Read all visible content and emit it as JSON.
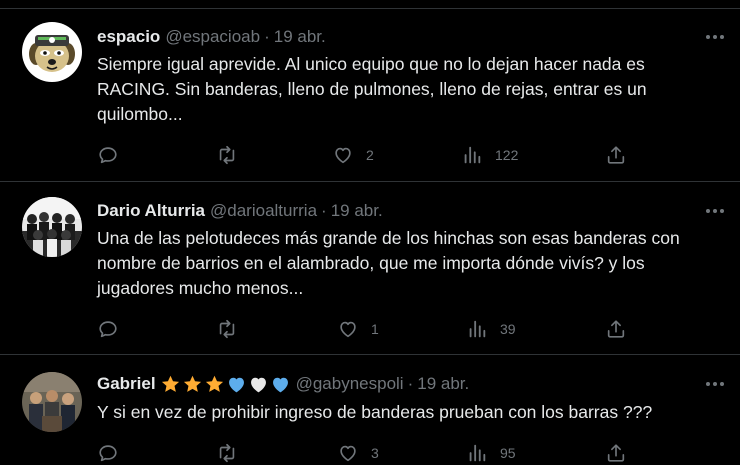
{
  "colors": {
    "background": "#000000",
    "text_primary": "#e7e9ea",
    "text_secondary": "#71767b",
    "divider": "#2f3336"
  },
  "tweets": [
    {
      "name": "espacio",
      "handle": "@espacioab",
      "separator": "·",
      "date": "19 abr.",
      "text": "Siempre igual aprevide. Al unico equipo que no lo dejan hacer nada es RACING. Sin banderas, lleno de pulmones, lleno de rejas, entrar es un quilombo...",
      "avatar_icon": "cartoon-dog-avatar",
      "replies": "",
      "retweets": "",
      "likes": "2",
      "views": "122"
    },
    {
      "name": "Dario Alturria",
      "handle": "@darioalturria",
      "separator": "·",
      "date": "19 abr.",
      "text": "Una de las pelotudeces más grande de los hinchas son esas banderas con nombre de barrios en el alambrado, que me importa dónde vivís? y los jugadores mucho menos...",
      "avatar_icon": "team-photo-avatar",
      "replies": "",
      "retweets": "",
      "likes": "1",
      "views": "39"
    },
    {
      "name": "Gabriel",
      "name_emojis": [
        "star",
        "star",
        "star",
        "blue-heart",
        "white-heart",
        "blue-heart"
      ],
      "handle": "@gabynespoli",
      "separator": "·",
      "date": "19 abr.",
      "text": "Y si en vez de prohibir ingreso de banderas prueban con los barras ???",
      "avatar_icon": "group-photo-avatar",
      "replies": "",
      "retweets": "",
      "likes": "3",
      "views": "95"
    }
  ]
}
